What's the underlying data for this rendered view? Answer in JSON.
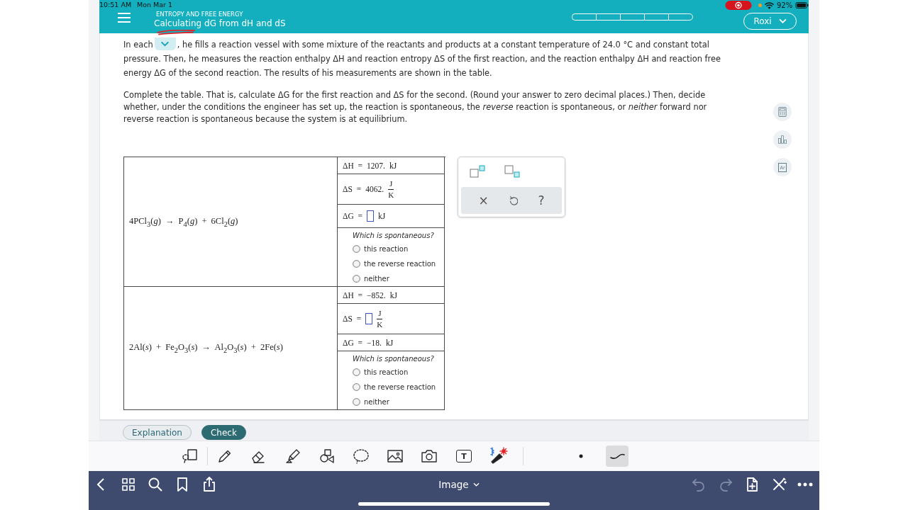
{
  "status_bar": {
    "time": "10:51 AM",
    "date": "Mon Mar 1",
    "battery": "92%"
  },
  "header": {
    "category": "ENTROPY AND FREE ENERGY",
    "title": "Calculating dG from dH and dS",
    "progress_segments": [
      {
        "filled": false
      },
      {
        "filled": false
      },
      {
        "filled": false
      },
      {
        "filled": false
      },
      {
        "filled": false
      }
    ],
    "user": "Roxi"
  },
  "problem": {
    "intro_before": "In each",
    "intro_after": ", he fills a reaction vessel with some mixture of the reactants and products at a constant temperature of 24.0 °C and constant total pressure. Then, he measures the reaction enthalpy ΔH and reaction entropy ΔS of the first reaction, and the reaction enthalpy ΔH and reaction free energy ΔG of the second reaction. The results of his measurements are shown in the table.",
    "instructions": "Complete the table. That is, calculate ΔG for the first reaction and ΔS for the second. (Round your answer to zero decimal places.) Then, decide whether, under the conditions the engineer has set up, the reaction is spontaneous, the *reverse* reaction is spontaneous, or *neither* forward nor reverse reaction is spontaneous because the system is at equilibrium."
  },
  "table": {
    "rows": [
      {
        "equation": "4PCl$_{3}$(*g*) → P$_{4}$(*g*) + 6Cl$_{2}$(*g*)",
        "quantities": [
          {
            "label": "ΔH =",
            "kind": "given",
            "value": "1207.",
            "unit": "kJ"
          },
          {
            "label": "ΔS =",
            "kind": "given",
            "value": "4062.",
            "unit": {
              "top": "J",
              "bottom": "K"
            }
          },
          {
            "label": "ΔG =",
            "kind": "blank",
            "unit": "kJ"
          }
        ],
        "question": "Which is spontaneous?",
        "options": [
          {
            "label": "this reaction",
            "selected": false
          },
          {
            "label": "the reverse reaction",
            "selected": false
          },
          {
            "label": "neither",
            "selected": false
          }
        ]
      },
      {
        "equation": "2Al(*s*) + Fe$_{2}$O$_{3}$(*s*) → Al$_{2}$O$_{3}$(*s*) + 2Fe(*s*)",
        "quantities": [
          {
            "label": "ΔH =",
            "kind": "given",
            "value": "−852.",
            "unit": "kJ"
          },
          {
            "label": "ΔS =",
            "kind": "blank",
            "unit": {
              "top": "J",
              "bottom": "K"
            }
          },
          {
            "label": "ΔG =",
            "kind": "given",
            "value": "−18.",
            "unit": "kJ"
          }
        ],
        "question": "Which is spontaneous?",
        "options": [
          {
            "label": "this reaction",
            "selected": false
          },
          {
            "label": "the reverse reaction",
            "selected": false
          },
          {
            "label": "neither",
            "selected": false
          }
        ]
      }
    ]
  },
  "palette": {
    "clear": "×",
    "help": "?"
  },
  "tools": [
    {
      "kind": "calculator"
    },
    {
      "kind": "data"
    },
    {
      "kind": "periodic-table",
      "label": "Ar"
    }
  ],
  "footer": {
    "buttons": [
      {
        "label": "Explanation",
        "kind": "secondary"
      },
      {
        "label": "Check",
        "kind": "primary"
      }
    ]
  },
  "annotation_toolbar": {
    "tools": [
      {
        "kind": "page-lasso",
        "selected": false
      },
      {
        "kind": "pencil",
        "selected": false
      },
      {
        "kind": "eraser",
        "selected": false
      },
      {
        "kind": "highlighter",
        "selected": false
      },
      {
        "kind": "shapes",
        "selected": false
      },
      {
        "kind": "lasso",
        "selected": false
      },
      {
        "kind": "image",
        "selected": false
      },
      {
        "kind": "camera",
        "selected": false
      },
      {
        "kind": "text",
        "label": "T",
        "selected": false
      },
      {
        "kind": "laser",
        "selected": false
      }
    ],
    "styles": [
      {
        "kind": "dot",
        "selected": false
      },
      {
        "kind": "stroke",
        "selected": true
      }
    ]
  },
  "nav_bar": {
    "title": "Image",
    "actions": [
      {
        "kind": "undo",
        "disabled": true
      },
      {
        "kind": "redo",
        "disabled": true
      },
      {
        "kind": "add-page",
        "disabled": false
      },
      {
        "kind": "markup-close",
        "disabled": false
      },
      {
        "kind": "more",
        "disabled": false
      }
    ]
  }
}
